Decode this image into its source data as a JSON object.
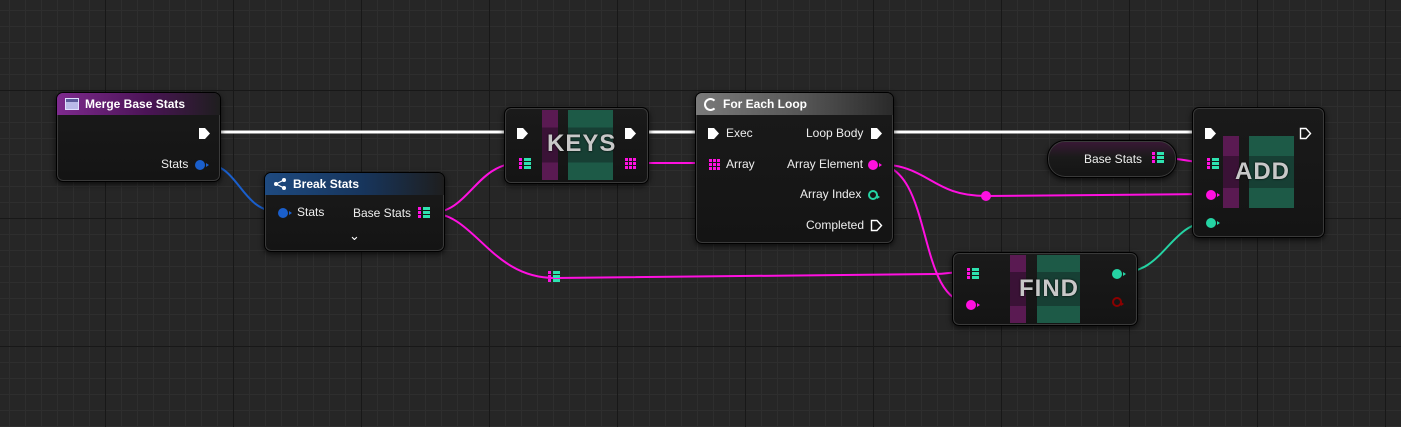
{
  "nodes": {
    "merge_base_stats": {
      "title": "Merge Base Stats",
      "pin_stats": "Stats"
    },
    "break_stats": {
      "title": "Break Stats",
      "pin_stats": "Stats",
      "pin_base_stats": "Base Stats",
      "expand_glyph": "⌄"
    },
    "keys": {
      "title": "KEYS"
    },
    "for_each_loop": {
      "title": "For Each Loop",
      "pin_exec": "Exec",
      "pin_array": "Array",
      "pin_loop_body": "Loop Body",
      "pin_array_element": "Array Element",
      "pin_array_index": "Array Index",
      "pin_completed": "Completed"
    },
    "base_stats_var": {
      "label": "Base Stats"
    },
    "add": {
      "title": "ADD"
    },
    "find": {
      "title": "FIND"
    }
  },
  "colors": {
    "background": "#262626",
    "exec_wire": "#ffffff",
    "struct_wire": "#1a5fcc",
    "map_key_wire": "#ff10e0",
    "map_value_wire": "#25d4a4",
    "bool_pin": "#8b0000",
    "function_header": "#7e2a8e",
    "break_header": "#1e4a80",
    "macro_header": "#777777"
  },
  "icons": {
    "merge": "function-icon",
    "break": "break-struct-icon",
    "loop": "loop-icon",
    "map_pin": "map-pin-icon",
    "exec_pin": "exec-pin-icon"
  }
}
